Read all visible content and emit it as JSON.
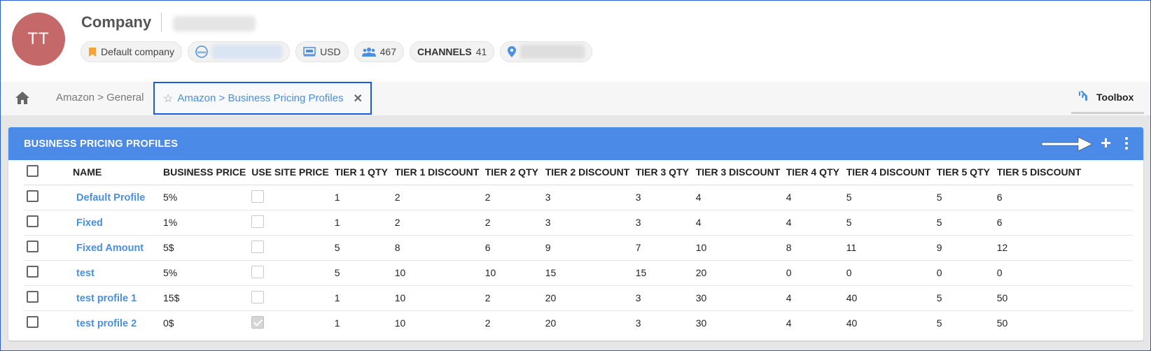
{
  "header": {
    "avatar_initials": "TT",
    "title": "Company",
    "chips": {
      "default_company": "Default company",
      "currency": "USD",
      "users_count": "467",
      "channels_label": "CHANNELS",
      "channels_count": "41"
    }
  },
  "tabs": {
    "general": "Amazon > General",
    "active": "Amazon > Business Pricing Profiles",
    "toolbox": "Toolbox"
  },
  "card": {
    "title": "BUSINESS PRICING PROFILES"
  },
  "table": {
    "columns": [
      "NAME",
      "BUSINESS PRICE",
      "USE SITE PRICE",
      "TIER 1 QTY",
      "TIER 1 DISCOUNT",
      "TIER 2 QTY",
      "TIER 2 DISCOUNT",
      "TIER 3 QTY",
      "TIER 3 DISCOUNT",
      "TIER 4 QTY",
      "TIER 4 DISCOUNT",
      "TIER 5 QTY",
      "TIER 5 DISCOUNT"
    ],
    "rows": [
      {
        "name": "Default Profile",
        "business_price": "5%",
        "use_site_price": false,
        "t1q": "1",
        "t1d": "2",
        "t2q": "2",
        "t2d": "3",
        "t3q": "3",
        "t3d": "4",
        "t4q": "4",
        "t4d": "5",
        "t5q": "5",
        "t5d": "6"
      },
      {
        "name": "Fixed",
        "business_price": "1%",
        "use_site_price": false,
        "t1q": "1",
        "t1d": "2",
        "t2q": "2",
        "t2d": "3",
        "t3q": "3",
        "t3d": "4",
        "t4q": "4",
        "t4d": "5",
        "t5q": "5",
        "t5d": "6"
      },
      {
        "name": "Fixed Amount",
        "business_price": "5$",
        "use_site_price": false,
        "t1q": "5",
        "t1d": "8",
        "t2q": "6",
        "t2d": "9",
        "t3q": "7",
        "t3d": "10",
        "t4q": "8",
        "t4d": "11",
        "t5q": "9",
        "t5d": "12"
      },
      {
        "name": "test",
        "business_price": "5%",
        "use_site_price": false,
        "t1q": "5",
        "t1d": "10",
        "t2q": "10",
        "t2d": "15",
        "t3q": "15",
        "t3d": "20",
        "t4q": "0",
        "t4d": "0",
        "t5q": "0",
        "t5d": "0"
      },
      {
        "name": "test profile 1",
        "business_price": "15$",
        "use_site_price": false,
        "t1q": "1",
        "t1d": "10",
        "t2q": "2",
        "t2d": "20",
        "t3q": "3",
        "t3d": "30",
        "t4q": "4",
        "t4d": "40",
        "t5q": "5",
        "t5d": "50"
      },
      {
        "name": "test profile 2",
        "business_price": "0$",
        "use_site_price": true,
        "t1q": "1",
        "t1d": "10",
        "t2q": "2",
        "t2d": "20",
        "t3q": "3",
        "t3d": "30",
        "t4q": "4",
        "t4d": "40",
        "t5q": "5",
        "t5d": "50"
      }
    ]
  },
  "colors": {
    "accent": "#4c8ae8",
    "link": "#4a8fe0",
    "avatar": "#c4686a",
    "tab_highlight": "#1f5bd6"
  }
}
